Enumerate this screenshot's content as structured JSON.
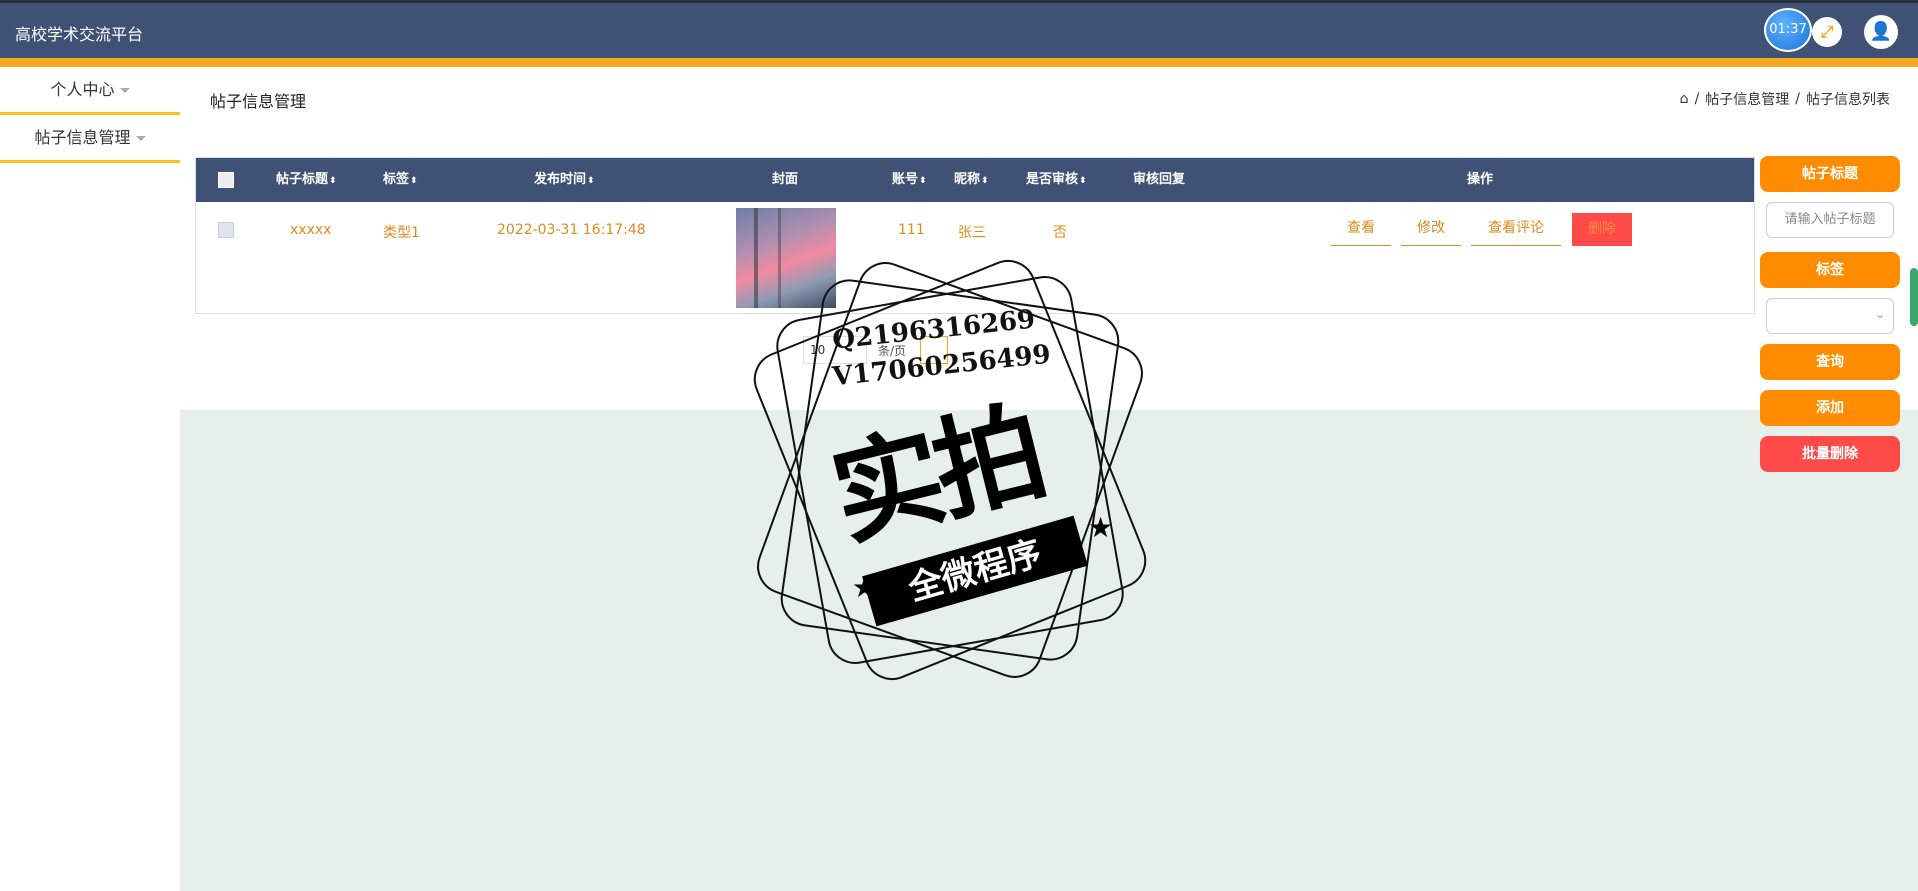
{
  "app": {
    "title": "高校学术交流平台",
    "timer": "01:37"
  },
  "header": {
    "expand_icon": "expand-icon",
    "user_icon": "user-icon"
  },
  "sidebar": {
    "items": [
      {
        "label": "个人中心"
      },
      {
        "label": "帖子信息管理"
      }
    ]
  },
  "page": {
    "title": "帖子信息管理",
    "breadcrumb": [
      "帖子信息管理",
      "帖子信息列表"
    ],
    "breadcrumb_sep": "/"
  },
  "table": {
    "columns": [
      "帖子标题",
      "标签",
      "发布时间",
      "封面",
      "账号",
      "昵称",
      "是否审核",
      "审核回复",
      "操作"
    ],
    "rows": [
      {
        "title": "xxxxx",
        "tag": "类型1",
        "time": "2022-03-31 16:17:48",
        "account": "111",
        "nickname": "张三",
        "audited": "否",
        "reply": "",
        "actions": [
          "查看",
          "修改",
          "查看评论",
          "删除"
        ]
      }
    ]
  },
  "pager": {
    "page_size": "10",
    "label": "条/页"
  },
  "search_panel": {
    "title_button": "帖子标题",
    "title_placeholder": "请输入帖子标题",
    "tag_button": "标签",
    "tag_value": "",
    "query_button": "查询",
    "add_button": "添加",
    "batch_delete_button": "批量删除"
  },
  "watermark": {
    "line1": "Q2196316269",
    "line2": "V17060256499",
    "main": "实拍",
    "ribbon": "全微程序"
  },
  "colors": {
    "header": "#3f5275",
    "accent": "#f5a81d",
    "button": "#ff8c00",
    "danger": "#ff4a4a"
  }
}
